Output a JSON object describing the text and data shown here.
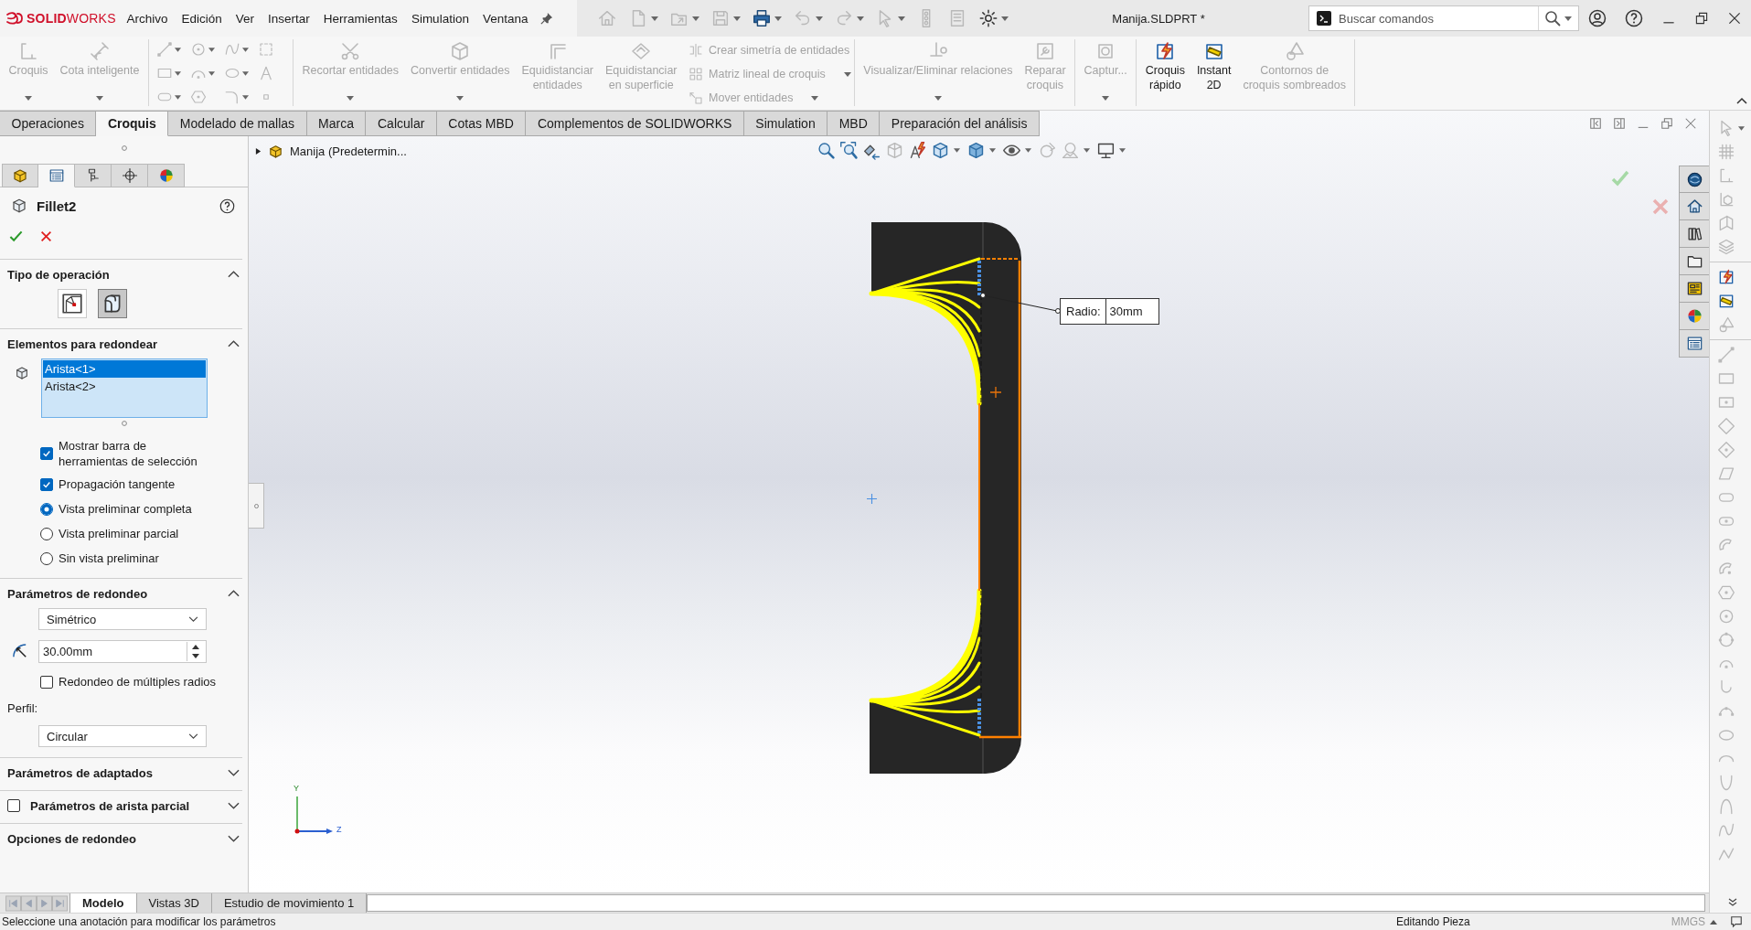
{
  "app_logo": "**SOLID**WORKS",
  "menu": [
    {
      "label": "Archivo"
    },
    {
      "label": "Edición"
    },
    {
      "label": "Ver"
    },
    {
      "label": "Insertar"
    },
    {
      "label": "Herramientas"
    },
    {
      "label": "Simulation"
    },
    {
      "label": "Ventana"
    }
  ],
  "quick_access": [
    {
      "kind": "home",
      "disabled": true,
      "dropdown": false
    },
    {
      "kind": "new",
      "disabled": true,
      "dropdown": true
    },
    {
      "kind": "open",
      "disabled": true,
      "dropdown": true
    },
    {
      "kind": "save",
      "disabled": true,
      "dropdown": true
    },
    {
      "kind": "print",
      "disabled": false,
      "dropdown": true
    },
    {
      "kind": "undo",
      "disabled": true,
      "dropdown": true
    },
    {
      "kind": "redo",
      "disabled": true,
      "dropdown": true
    },
    {
      "kind": "select",
      "disabled": true,
      "dropdown": true
    },
    {
      "kind": "rebuild",
      "disabled": true,
      "dropdown": false
    },
    {
      "kind": "properties",
      "disabled": true,
      "dropdown": false
    },
    {
      "kind": "options",
      "disabled": false,
      "dropdown": true
    }
  ],
  "document_title": "Manija.SLDPRT *",
  "search": {
    "placeholder": "Buscar comandos"
  },
  "command_manager": [
    {
      "blocks": [
        {
          "kind": "buttons",
          "items": [
            {
              "kind": "sketch",
              "label": "Croquis",
              "disabled": true,
              "dropdown": true
            },
            {
              "kind": "dimension",
              "label": "Cota inteligente",
              "disabled": true,
              "dropdown": true
            }
          ]
        }
      ]
    },
    {
      "blocks": [
        {
          "kind": "grid",
          "items": [
            {
              "kind": "line",
              "disabled": true,
              "dropdown": true
            },
            {
              "kind": "circle",
              "disabled": true,
              "dropdown": true
            },
            {
              "kind": "spline",
              "disabled": true,
              "dropdown": true
            },
            {
              "kind": "sketchgrid",
              "disabled": true,
              "dropdown": false
            },
            {
              "kind": "rectangle",
              "disabled": true,
              "dropdown": true
            },
            {
              "kind": "arc",
              "disabled": true,
              "dropdown": true
            },
            {
              "kind": "ellipse",
              "disabled": true,
              "dropdown": true
            },
            {
              "kind": "text",
              "disabled": true,
              "dropdown": false
            },
            {
              "kind": "slot",
              "disabled": true,
              "dropdown": true
            },
            {
              "kind": "polygon",
              "disabled": true,
              "dropdown": false
            },
            {
              "kind": "fillet",
              "disabled": true,
              "dropdown": true
            },
            {
              "kind": "point",
              "disabled": true,
              "dropdown": false
            }
          ]
        }
      ]
    },
    {
      "blocks": [
        {
          "kind": "buttons",
          "items": [
            {
              "kind": "trim",
              "label": "Recortar entidades",
              "disabled": true,
              "dropdown": true
            },
            {
              "kind": "convert",
              "label": "Convertir entidades",
              "disabled": true,
              "dropdown": true
            },
            {
              "kind": "offset",
              "label": "Equidistanciar\nentidades",
              "disabled": true,
              "dropdown": false
            },
            {
              "kind": "surface",
              "label": "Equidistanciar\nen superficie",
              "disabled": true,
              "dropdown": false
            }
          ]
        },
        {
          "kind": "list",
          "items": [
            {
              "kind": "mirror",
              "label": "Crear simetría de entidades",
              "disabled": true,
              "dropdown": false
            },
            {
              "kind": "pattern",
              "label": "Matriz lineal de croquis",
              "disabled": true,
              "dropdown": true
            },
            {
              "kind": "move",
              "label": "Mover entidades",
              "disabled": true,
              "dropdown": true
            }
          ]
        }
      ]
    },
    {
      "blocks": [
        {
          "kind": "buttons",
          "items": [
            {
              "kind": "relations",
              "label": "Visualizar/Eliminar relaciones",
              "disabled": true,
              "dropdown": true
            },
            {
              "kind": "repair",
              "label": "Reparar\ncroquis",
              "disabled": true,
              "dropdown": false
            }
          ]
        }
      ]
    },
    {
      "blocks": [
        {
          "kind": "buttons",
          "items": [
            {
              "kind": "capture",
              "label": "Captur...",
              "disabled": true,
              "dropdown": true
            }
          ]
        }
      ]
    },
    {
      "blocks": [
        {
          "kind": "buttons",
          "items": [
            {
              "kind": "rapid",
              "label": "Croquis\nrápido",
              "disabled": false,
              "dropdown": false
            },
            {
              "kind": "instant2d",
              "label": "Instant\n2D",
              "disabled": false,
              "dropdown": false
            },
            {
              "kind": "shaded",
              "label": "Contornos de\ncroquis sombreados",
              "disabled": true,
              "dropdown": false
            }
          ]
        }
      ]
    }
  ],
  "command_tabs": [
    {
      "label": "Operaciones",
      "selected": false
    },
    {
      "label": "Croquis",
      "selected": true
    },
    {
      "label": "Modelado de mallas",
      "selected": false
    },
    {
      "label": "Marca",
      "selected": false
    },
    {
      "label": "Calcular",
      "selected": false
    },
    {
      "label": "Cotas MBD",
      "selected": false
    },
    {
      "label": "Complementos de SOLIDWORKS",
      "selected": false
    },
    {
      "label": "Simulation",
      "selected": false
    },
    {
      "label": "MBD",
      "selected": false
    },
    {
      "label": "Preparación del análisis",
      "selected": false
    }
  ],
  "property_manager": {
    "tabs": [
      {
        "kind": "featuretree",
        "selected": false
      },
      {
        "kind": "propertymanager",
        "selected": true
      },
      {
        "kind": "configurationmanager",
        "selected": false
      },
      {
        "kind": "dimxpertmanager",
        "selected": false
      },
      {
        "kind": "displaymanager",
        "selected": false
      }
    ],
    "title": "Fillet2",
    "sections": [
      {
        "title": "Tipo de operación",
        "expanded": true,
        "controls": [
          {
            "kind": "choice",
            "options": [
              {
                "kind": "chamfer",
                "selected": false
              },
              {
                "kind": "roundcube",
                "selected": true
              }
            ]
          }
        ]
      },
      {
        "title": "Elementos para redondear",
        "expanded": true,
        "controls": [
          {
            "kind": "listbox",
            "items": [
              {
                "label": "Arista<1>",
                "selected": true
              },
              {
                "label": "Arista<2>",
                "selected": false
              }
            ]
          },
          {
            "kind": "checkbox",
            "label": "Mostrar barra de\nherramientas de selección",
            "checked": true
          },
          {
            "kind": "checkbox",
            "label": "Propagación tangente",
            "checked": true
          },
          {
            "kind": "radio",
            "label": "Vista preliminar completa",
            "selected": true
          },
          {
            "kind": "radio",
            "label": "Vista preliminar parcial",
            "selected": false
          },
          {
            "kind": "radio",
            "label": "Sin vista preliminar",
            "selected": false
          }
        ]
      },
      {
        "title": "Parámetros de redondeo",
        "expanded": true,
        "controls": [
          {
            "kind": "dropdown",
            "value": "Simétrico"
          },
          {
            "kind": "spin",
            "value": "30.00mm"
          },
          {
            "kind": "checkbox",
            "label": "Redondeo de múltiples radios",
            "checked": false
          },
          {
            "kind": "label",
            "label": "Perfil:"
          },
          {
            "kind": "dropdown",
            "value": "Circular"
          }
        ]
      },
      {
        "title": "Parámetros de adaptados",
        "expanded": false
      },
      {
        "title": "Parámetros de arista parcial",
        "expanded": false,
        "checked": false
      },
      {
        "title": "Opciones de redondeo",
        "expanded": false
      }
    ]
  },
  "graphics": {
    "feature_tree": {
      "label": "Manija (Predetermin...",
      "expanded": false
    },
    "view_tools": [
      {
        "kind": "zoomfit",
        "disabled": false,
        "dropdown": false
      },
      {
        "kind": "zoomarea",
        "disabled": false,
        "dropdown": false
      },
      {
        "kind": "previous",
        "disabled": false,
        "dropdown": false
      },
      {
        "kind": "section",
        "disabled": true,
        "dropdown": false
      },
      {
        "kind": "annotation",
        "disabled": false,
        "dropdown": false
      },
      {
        "kind": "orientation",
        "disabled": false,
        "dropdown": true
      },
      {
        "kind": "displaystyle",
        "disabled": false,
        "dropdown": true
      },
      {
        "kind": "hide",
        "disabled": false,
        "dropdown": true
      },
      {
        "kind": "appearance",
        "disabled": true,
        "dropdown": false
      },
      {
        "kind": "scene",
        "disabled": true,
        "dropdown": true
      },
      {
        "kind": "settings",
        "disabled": false,
        "dropdown": true
      }
    ],
    "callout": {
      "label": "Radio:",
      "value": "30mm"
    },
    "axes": [
      {
        "label": "Y"
      },
      {
        "label": "Z"
      }
    ]
  },
  "model_tabs": [
    {
      "label": "Modelo",
      "selected": true
    },
    {
      "label": "Vistas 3D",
      "selected": false
    },
    {
      "label": "Estudio de movimiento 1",
      "selected": false
    }
  ],
  "sketch_toolbar": [
    {
      "tools": [
        {
          "kind": "pointer",
          "disabled": true,
          "dropdown": true
        },
        {
          "kind": "grid",
          "disabled": true,
          "dropdown": false
        },
        {
          "kind": "sketch",
          "disabled": true,
          "dropdown": false
        },
        {
          "kind": "sketch3d",
          "disabled": true,
          "dropdown": false
        },
        {
          "kind": "plane",
          "disabled": true,
          "dropdown": false
        },
        {
          "kind": "layers",
          "disabled": true,
          "dropdown": false
        }
      ]
    },
    {
      "tools": [
        {
          "kind": "rapid",
          "disabled": false,
          "dropdown": false
        },
        {
          "kind": "instant2d",
          "disabled": false,
          "dropdown": false
        },
        {
          "kind": "shaded",
          "disabled": true,
          "dropdown": false
        }
      ]
    },
    {
      "tools": [
        {
          "kind": "line",
          "disabled": true,
          "dropdown": false
        },
        {
          "kind": "rectangle",
          "disabled": true,
          "dropdown": false
        },
        {
          "kind": "rectcenter",
          "disabled": true,
          "dropdown": false
        },
        {
          "kind": "rect3pt",
          "disabled": true,
          "dropdown": false
        },
        {
          "kind": "rect3ptcenter",
          "disabled": true,
          "dropdown": false
        },
        {
          "kind": "parallelogram",
          "disabled": true,
          "dropdown": false
        },
        {
          "kind": "slot",
          "disabled": true,
          "dropdown": false
        },
        {
          "kind": "slotcenter",
          "disabled": true,
          "dropdown": false
        },
        {
          "kind": "slotarc",
          "disabled": true,
          "dropdown": false
        },
        {
          "kind": "slotarc2",
          "disabled": true,
          "dropdown": false
        },
        {
          "kind": "polygon",
          "disabled": true,
          "dropdown": false
        },
        {
          "kind": "circle",
          "disabled": true,
          "dropdown": false
        },
        {
          "kind": "circleperim",
          "disabled": true,
          "dropdown": false
        },
        {
          "kind": "arccenter",
          "disabled": true,
          "dropdown": false
        },
        {
          "kind": "arctangent",
          "disabled": true,
          "dropdown": false
        },
        {
          "kind": "arc3pt",
          "disabled": true,
          "dropdown": false
        },
        {
          "kind": "ellipse",
          "disabled": true,
          "dropdown": false
        },
        {
          "kind": "partialellipse",
          "disabled": true,
          "dropdown": false
        },
        {
          "kind": "parabola",
          "disabled": true,
          "dropdown": false
        },
        {
          "kind": "conic",
          "disabled": true,
          "dropdown": false
        },
        {
          "kind": "spline",
          "disabled": true,
          "dropdown": false
        },
        {
          "kind": "stylespline",
          "disabled": true,
          "dropdown": false
        }
      ]
    }
  ],
  "status_bar": {
    "message": "Seleccione una anotación para modificar los parámetros",
    "mode": "Editando Pieza",
    "units": "MMGS"
  }
}
